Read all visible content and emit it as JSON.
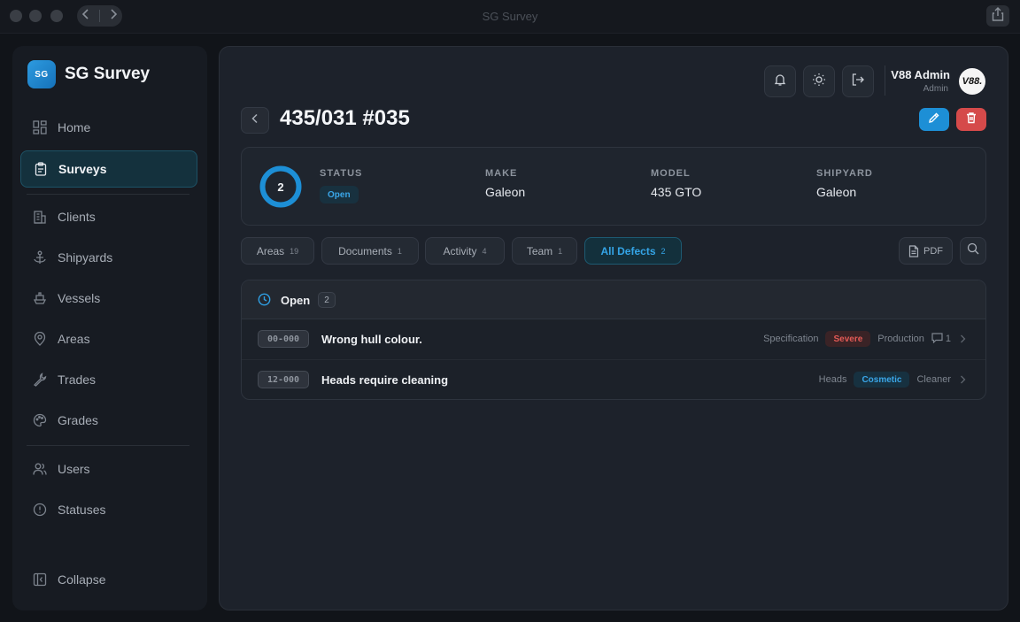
{
  "window": {
    "title": "SG Survey"
  },
  "brand": {
    "logo": "SG",
    "name": "SG Survey"
  },
  "sidebar": {
    "items": [
      {
        "label": "Home",
        "icon": "grid-icon"
      },
      {
        "label": "Surveys",
        "icon": "clipboard-icon",
        "active": true
      },
      {
        "label": "Clients",
        "icon": "building-icon"
      },
      {
        "label": "Shipyards",
        "icon": "anchor-icon"
      },
      {
        "label": "Vessels",
        "icon": "ship-icon"
      },
      {
        "label": "Areas",
        "icon": "map-pin-icon"
      },
      {
        "label": "Trades",
        "icon": "wrench-icon"
      },
      {
        "label": "Grades",
        "icon": "palette-icon"
      },
      {
        "label": "Users",
        "icon": "users-icon"
      },
      {
        "label": "Statuses",
        "icon": "alert-circle-icon"
      }
    ],
    "collapse_label": "Collapse"
  },
  "user": {
    "name": "V88 Admin",
    "role": "Admin",
    "avatar": "V88."
  },
  "page": {
    "title": "435/031 #035"
  },
  "info": {
    "ring_count": "2",
    "status_label": "STATUS",
    "status_value": "Open",
    "make_label": "MAKE",
    "make_value": "Galeon",
    "model_label": "MODEL",
    "model_value": "435 GTO",
    "shipyard_label": "SHIPYARD",
    "shipyard_value": "Galeon"
  },
  "tabs": [
    {
      "label": "Areas",
      "count": "19"
    },
    {
      "label": "Documents",
      "count": "1"
    },
    {
      "label": "Activity",
      "count": "4"
    },
    {
      "label": "Team",
      "count": "1"
    },
    {
      "label": "All Defects",
      "count": "2",
      "active": true
    }
  ],
  "pdf_label": "PDF",
  "defect_group": {
    "title": "Open",
    "count": "2",
    "rows": [
      {
        "code": "00-000",
        "title": "Wrong hull colour.",
        "area": "Specification",
        "grade": "Severe",
        "trade": "Production",
        "comments": "1"
      },
      {
        "code": "12-000",
        "title": "Heads require cleaning",
        "area": "Heads",
        "grade": "Cosmetic",
        "trade": "Cleaner"
      }
    ]
  },
  "colors": {
    "accent": "#1d8fd6",
    "danger": "#d54a4a",
    "severe": "#e45a56",
    "cosmetic": "#3aa6e8"
  }
}
